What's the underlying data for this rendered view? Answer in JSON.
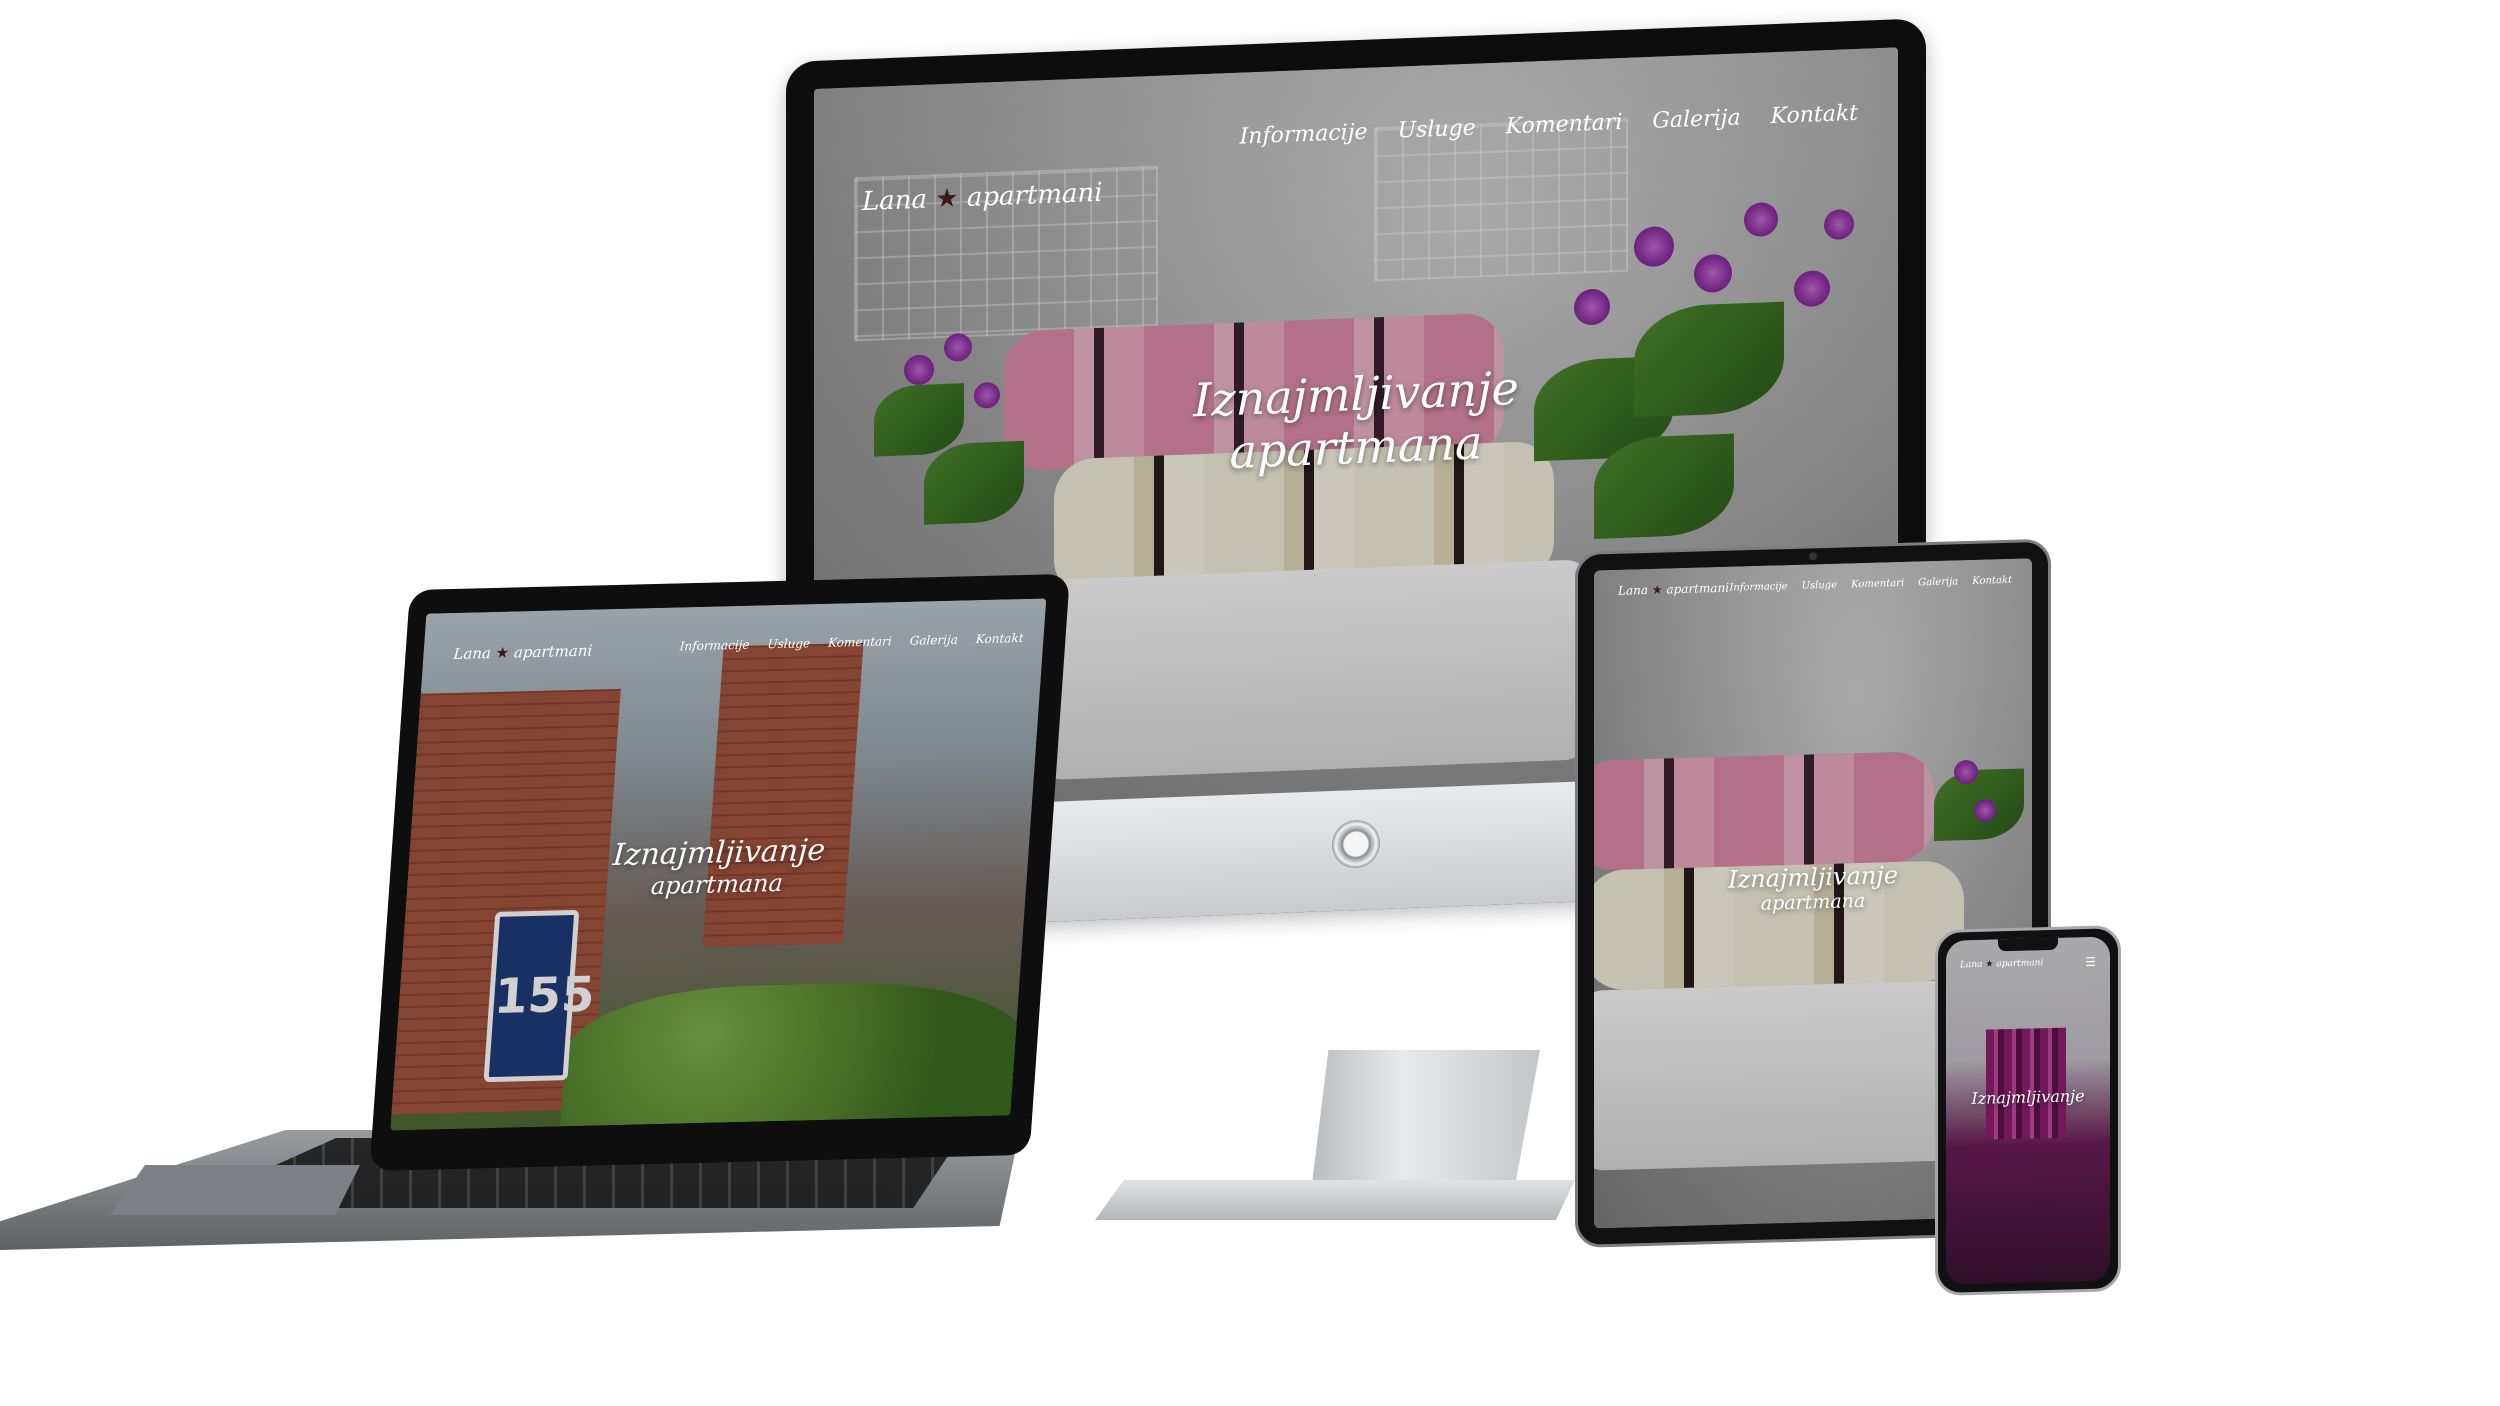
{
  "site": {
    "logo_script": "Lana",
    "logo_rest": "apartmani",
    "nav": [
      "Informacije",
      "Usluge",
      "Komentari",
      "Galerija",
      "Kontakt"
    ],
    "hero_line1": "Iznajmljivanje",
    "hero_line2": "apartmana"
  },
  "laptop_scene": {
    "house_number": "155"
  },
  "phone_scene": {
    "menu_icon": "hamburger-menu-icon",
    "hero_line1": "Iznajmljivanje"
  },
  "colors": {
    "nav_text": "#ffffff",
    "logo_star": "#3a1a1a",
    "sign_blue": "#1f3b7c"
  }
}
